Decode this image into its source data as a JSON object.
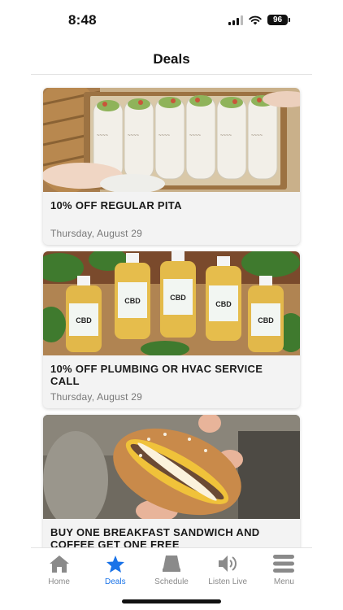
{
  "status_bar": {
    "time": "8:48",
    "battery": "96"
  },
  "header": {
    "title": "Deals"
  },
  "deals": [
    {
      "title": "10% OFF REGULAR PITA",
      "date": "Thursday, August 29",
      "image": "pita-wraps-photo"
    },
    {
      "title": "10% OFF PLUMBING OR HVAC SERVICE CALL",
      "date": "Thursday, August 29",
      "image": "cbd-oil-bottles-photo"
    },
    {
      "title": "BUY ONE BREAKFAST SANDWICH AND COFFEE GET ONE FREE",
      "date": "",
      "image": "breakfast-sandwich-photo"
    }
  ],
  "tabbar": {
    "accent_color": "#1a73e8",
    "items": [
      {
        "label": "Home",
        "icon": "house-icon",
        "active": false
      },
      {
        "label": "Deals",
        "icon": "star-icon",
        "active": true
      },
      {
        "label": "Schedule",
        "icon": "calendar-icon",
        "active": false
      },
      {
        "label": "Listen Live",
        "icon": "speaker-icon",
        "active": false
      },
      {
        "label": "Menu",
        "icon": "menu-icon",
        "active": false
      }
    ]
  }
}
